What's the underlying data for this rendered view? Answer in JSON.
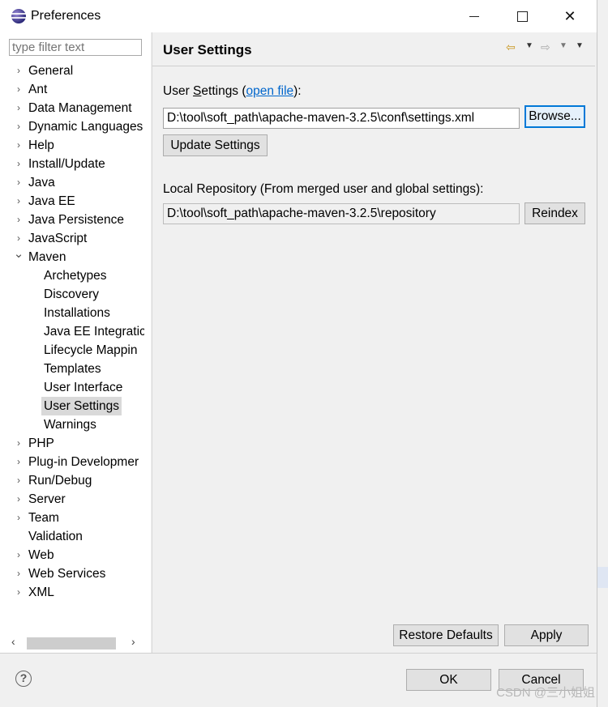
{
  "window": {
    "title": "Preferences",
    "icon": "eclipse-icon"
  },
  "filter": {
    "placeholder": "type filter text"
  },
  "tree": [
    {
      "label": "General",
      "expander": "collapsed"
    },
    {
      "label": "Ant",
      "expander": "collapsed"
    },
    {
      "label": "Data Management",
      "expander": "collapsed"
    },
    {
      "label": "Dynamic Languages",
      "expander": "collapsed"
    },
    {
      "label": "Help",
      "expander": "collapsed"
    },
    {
      "label": "Install/Update",
      "expander": "collapsed"
    },
    {
      "label": "Java",
      "expander": "collapsed"
    },
    {
      "label": "Java EE",
      "expander": "collapsed"
    },
    {
      "label": "Java Persistence",
      "expander": "collapsed"
    },
    {
      "label": "JavaScript",
      "expander": "collapsed"
    },
    {
      "label": "Maven",
      "expander": "expanded"
    },
    {
      "label": "Archetypes",
      "child": true
    },
    {
      "label": "Discovery",
      "child": true
    },
    {
      "label": "Installations",
      "child": true
    },
    {
      "label": "Java EE Integratic",
      "child": true
    },
    {
      "label": "Lifecycle Mappin",
      "child": true
    },
    {
      "label": "Templates",
      "child": true
    },
    {
      "label": "User Interface",
      "child": true
    },
    {
      "label": "User Settings",
      "child": true,
      "selected": true
    },
    {
      "label": "Warnings",
      "child": true
    },
    {
      "label": "PHP",
      "expander": "collapsed"
    },
    {
      "label": "Plug-in Developmer",
      "expander": "collapsed"
    },
    {
      "label": "Run/Debug",
      "expander": "collapsed"
    },
    {
      "label": "Server",
      "expander": "collapsed"
    },
    {
      "label": "Team",
      "expander": "collapsed"
    },
    {
      "label": "Validation",
      "expander": "none"
    },
    {
      "label": "Web",
      "expander": "collapsed"
    },
    {
      "label": "Web Services",
      "expander": "collapsed"
    },
    {
      "label": "XML",
      "expander": "collapsed"
    }
  ],
  "page": {
    "title": "User Settings",
    "user_settings_label_pre": "User ",
    "user_settings_label_mnemonic": "S",
    "user_settings_label_post": "ettings (",
    "open_file_link": "open file",
    "user_settings_label_end": "):",
    "user_settings_value": "D:\\tool\\soft_path\\apache-maven-3.2.5\\conf\\settings.xml",
    "browse_button": "Browse...",
    "update_button": "Update Settings",
    "local_repo_label": "Local Repository (From merged user and global settings):",
    "local_repo_value": "D:\\tool\\soft_path\\apache-maven-3.2.5\\repository",
    "reindex_button": "Reindex",
    "restore_button": "Restore Defaults",
    "apply_button": "Apply"
  },
  "footer": {
    "ok": "OK",
    "cancel": "Cancel"
  },
  "watermark": "CSDN @三小姐姐",
  "colors": {
    "selection": "#d9d9d9",
    "link": "#0066cc",
    "focus_border": "#0078d7"
  }
}
